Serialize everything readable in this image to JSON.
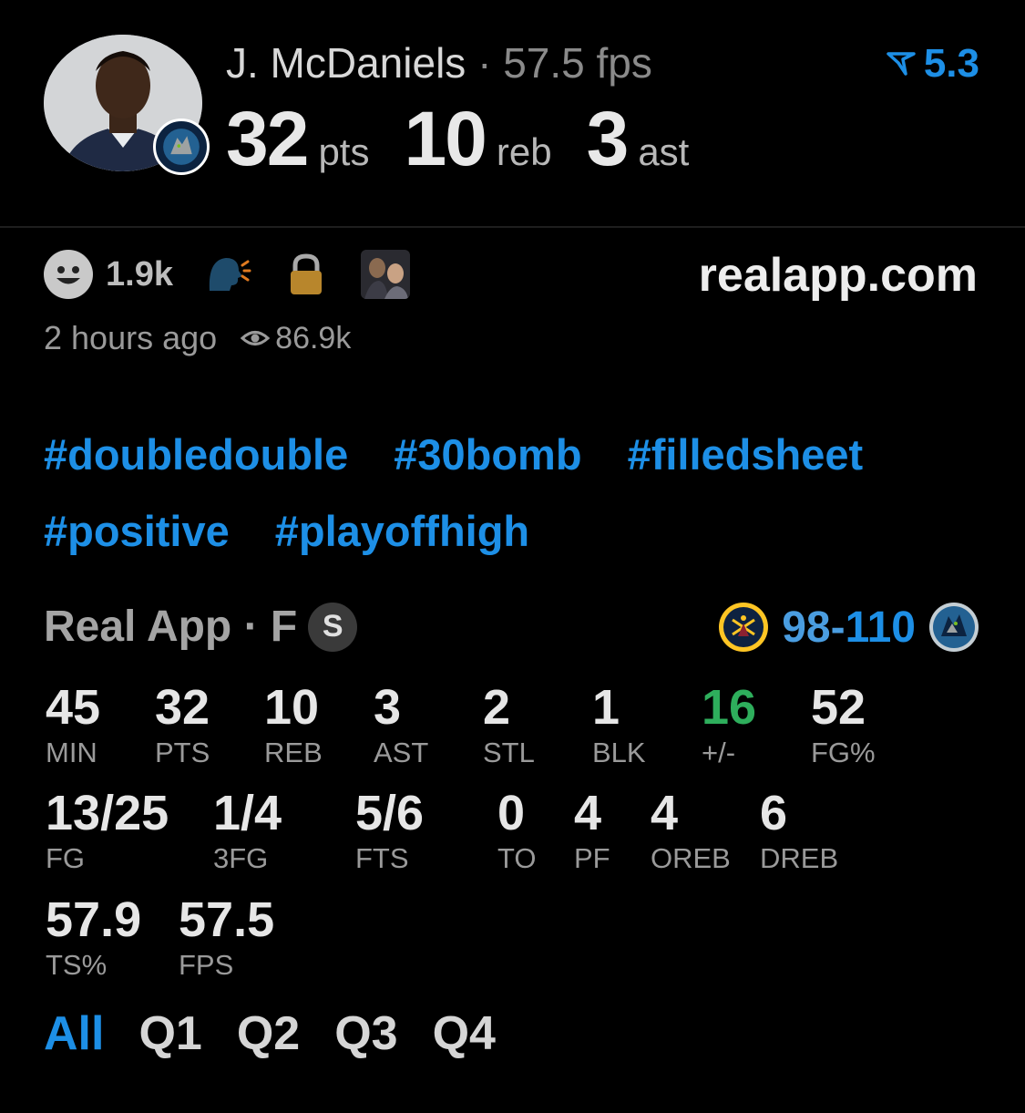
{
  "player": {
    "name": "J. McDaniels",
    "separator": "·",
    "fps_text": "57.5 fps",
    "rating": "5.3"
  },
  "headline": {
    "pts": "32",
    "pts_unit": "pts",
    "reb": "10",
    "reb_unit": "reb",
    "ast": "3",
    "ast_unit": "ast"
  },
  "post": {
    "reaction_count": "1.9k",
    "domain": "realapp.com",
    "time_ago": "2 hours ago",
    "views": "86.9k"
  },
  "tags": {
    "row1": [
      "#doubledouble",
      "#30bomb",
      "#filledsheet"
    ],
    "row2": [
      "#positive",
      "#playoffhigh"
    ]
  },
  "game": {
    "source": "Real App · F",
    "badge": "S",
    "score_away": "98",
    "score_dash": "-",
    "score_home": "110"
  },
  "stats_row1": [
    {
      "value": "45",
      "label": "MIN"
    },
    {
      "value": "32",
      "label": "PTS"
    },
    {
      "value": "10",
      "label": "REB"
    },
    {
      "value": "3",
      "label": "AST"
    },
    {
      "value": "2",
      "label": "STL"
    },
    {
      "value": "1",
      "label": "BLK"
    },
    {
      "value": "16",
      "label": "+/-"
    },
    {
      "value": "52",
      "label": "FG%"
    }
  ],
  "stats_row2": [
    {
      "value": "13/25",
      "label": "FG"
    },
    {
      "value": "1/4",
      "label": "3FG"
    },
    {
      "value": "5/6",
      "label": "FTS"
    },
    {
      "value": "0",
      "label": "TO"
    },
    {
      "value": "4",
      "label": "PF"
    },
    {
      "value": "4",
      "label": "OREB"
    },
    {
      "value": "6",
      "label": "DREB"
    }
  ],
  "stats_row3": [
    {
      "value": "57.9",
      "label": "TS%"
    },
    {
      "value": "57.5",
      "label": "FPS"
    }
  ],
  "quarters": [
    "All",
    "Q1",
    "Q2",
    "Q3",
    "Q4"
  ],
  "colors": {
    "accent_blue": "#1d8fe6",
    "positive_green": "#2eae5c",
    "background": "#000000"
  },
  "icons": {
    "rating": "real-app-logo-icon",
    "reaction": "smiley-icon",
    "speaking": "speaking-head-icon",
    "lock": "lock-icon",
    "thumbnail": "player-thumbnail-icon",
    "views": "eye-icon",
    "away_team": "nuggets-logo-icon",
    "home_team": "timberwolves-logo-icon"
  }
}
